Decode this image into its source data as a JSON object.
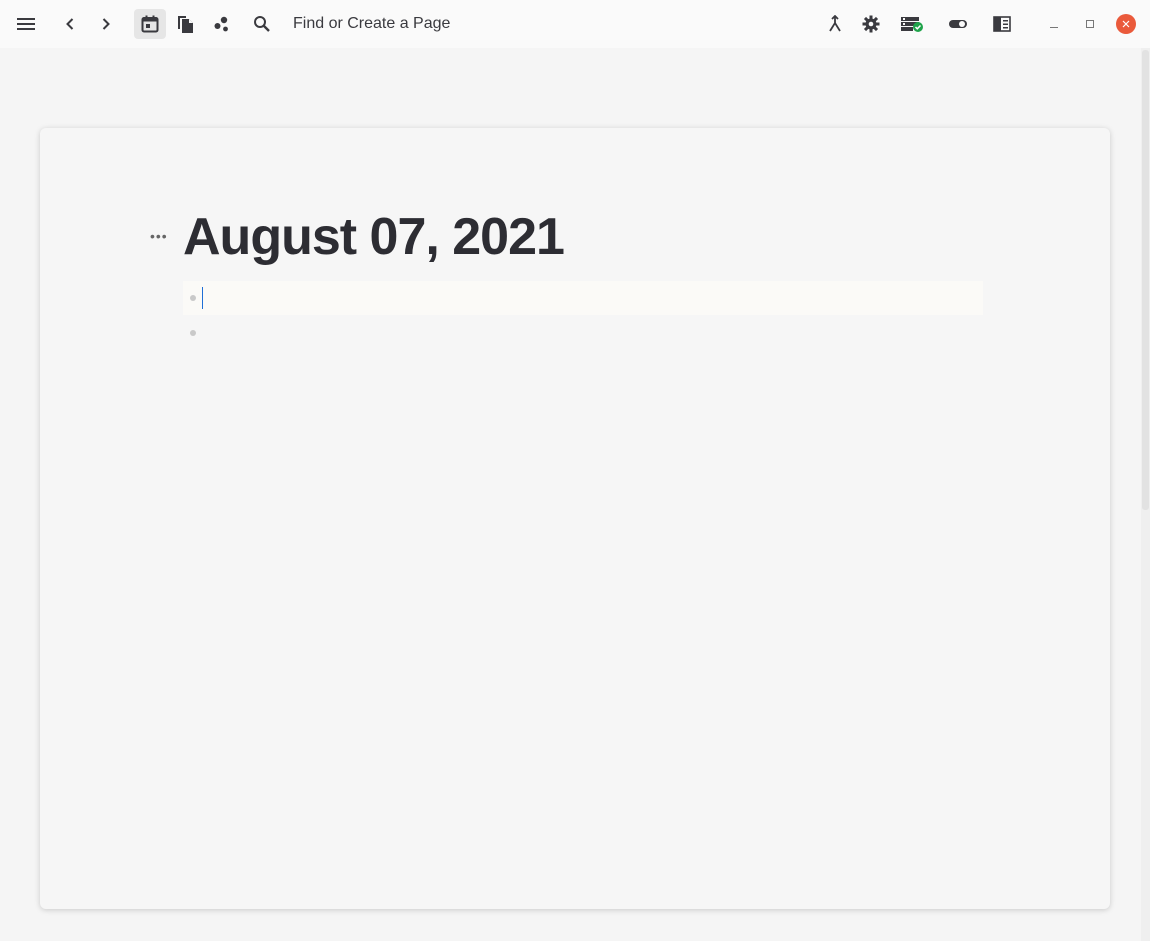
{
  "toolbar": {
    "search_placeholder": "Find or Create a Page",
    "icons": {
      "menu": "menu-icon",
      "back": "chevron-left-icon",
      "forward": "chevron-right-icon",
      "journals": "calendar-icon",
      "all_pages": "pages-icon",
      "graph": "graph-icon",
      "search": "search-icon",
      "merge": "merge-icon",
      "settings": "gear-icon",
      "sync": "sync-status-icon",
      "toggle": "toggle-icon",
      "sidebar": "right-sidebar-icon"
    }
  },
  "window_controls": {
    "minimize": "_",
    "maximize": "□",
    "close": "×"
  },
  "page": {
    "title": "August 07, 2021",
    "blocks": [
      {
        "text": "",
        "editing": true
      },
      {
        "text": "",
        "editing": false
      }
    ]
  },
  "colors": {
    "accent_close": "#ea5a3b",
    "sync_ok": "#1fa34a",
    "caret": "#1f6fd6"
  }
}
